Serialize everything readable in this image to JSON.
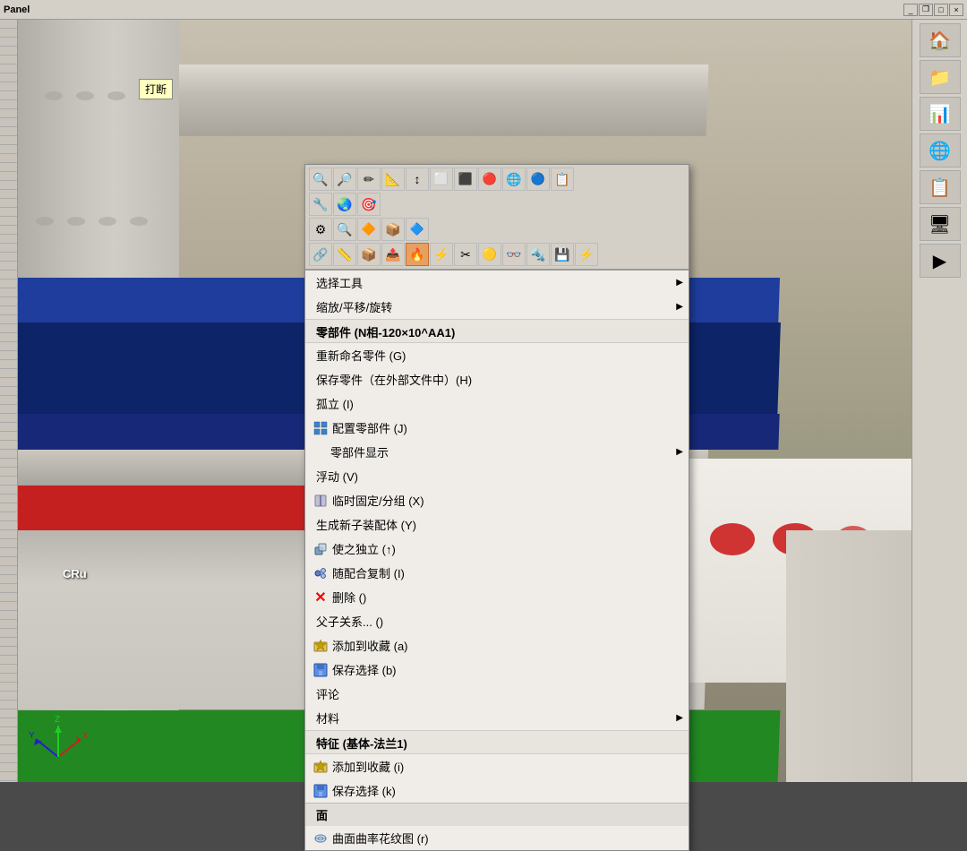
{
  "app": {
    "title": "Panel"
  },
  "titleControls": {
    "minimize": "_",
    "maximize": "□",
    "restore": "❐",
    "close": "×"
  },
  "rightPanel": {
    "icons": [
      "🏠",
      "📁",
      "📊",
      "🌐",
      "📋",
      "🖥",
      "▶"
    ]
  },
  "tooltip": {
    "text": "打断"
  },
  "contextMenu": {
    "toolbar": {
      "row1": [
        "🔍",
        "🔎",
        "✏",
        "📐",
        "↕",
        "⬜",
        "⬛",
        "🔴",
        "🌐",
        "🔵",
        "📋"
      ],
      "row2": [
        "🔧",
        "🌏",
        "🎯"
      ],
      "row3": [
        "⚙",
        "🔍",
        "🔶",
        "📦",
        "🔷"
      ],
      "row4": [
        "🔗",
        "📏",
        "📦",
        "📤",
        "🔥",
        "⚡",
        "✂",
        "🟡",
        "👓",
        "🔩",
        "💾",
        "⚡"
      ]
    },
    "items": [
      {
        "id": "select-tool",
        "text": "选择工具",
        "hasSubmenu": true,
        "hasIcon": false
      },
      {
        "id": "scale-move-rotate",
        "text": "缩放/平移/旋转",
        "hasSubmenu": true,
        "hasIcon": false
      },
      {
        "id": "section-header-part",
        "text": "零部件 (N相-120×10^AA1)",
        "isHeader": true
      },
      {
        "id": "rename",
        "text": "重新命名零件 (G)",
        "hasIcon": false
      },
      {
        "id": "save-external",
        "text": "保存零件（在外部文件中）(H)",
        "hasIcon": false
      },
      {
        "id": "isolate",
        "text": "孤立 (I)",
        "hasIcon": false
      },
      {
        "id": "config-parts",
        "text": "配置零部件 (J)",
        "hasIcon": true,
        "icon": "config"
      },
      {
        "id": "part-display",
        "text": "零部件显示",
        "hasSubmenu": true,
        "hasIcon": false
      },
      {
        "id": "float",
        "text": "浮动 (V)",
        "hasIcon": false
      },
      {
        "id": "temp-fix",
        "text": "临时固定/分组 (X)",
        "hasIcon": true,
        "icon": "fix"
      },
      {
        "id": "gen-subassembly",
        "text": "生成新子装配体 (Y)",
        "hasIcon": false
      },
      {
        "id": "make-independent",
        "text": "使之独立 (↑)",
        "hasIcon": true,
        "icon": "independent"
      },
      {
        "id": "random-copy",
        "text": "随配合复制 (I)",
        "hasIcon": true,
        "icon": "copy"
      },
      {
        "id": "delete",
        "text": "删除 ()",
        "hasIcon": true,
        "icon": "delete",
        "isDelete": true
      },
      {
        "id": "parent-child",
        "text": "父子关系... ()",
        "hasIcon": false
      },
      {
        "id": "add-to-favorites",
        "text": "添加到收藏 (a)",
        "hasIcon": true,
        "icon": "star"
      },
      {
        "id": "save-selection",
        "text": "保存选择 (b)",
        "hasIcon": true,
        "icon": "save"
      },
      {
        "id": "comment",
        "text": "评论",
        "hasIcon": false
      },
      {
        "id": "material",
        "text": "材料",
        "hasSubmenu": true,
        "hasIcon": false
      },
      {
        "id": "section-header-feature",
        "text": "特征 (基体-法兰1)",
        "isHeader": true
      },
      {
        "id": "add-to-favorites2",
        "text": "添加到收藏 (i)",
        "hasIcon": true,
        "icon": "star2"
      },
      {
        "id": "save-selection2",
        "text": "保存选择 (k)",
        "hasIcon": true,
        "icon": "save2"
      },
      {
        "id": "face-section",
        "text": "面",
        "isFaceSection": true
      },
      {
        "id": "surface-contour",
        "text": "曲面曲率花纹图  (r)",
        "hasIcon": true,
        "icon": "surface"
      }
    ]
  }
}
